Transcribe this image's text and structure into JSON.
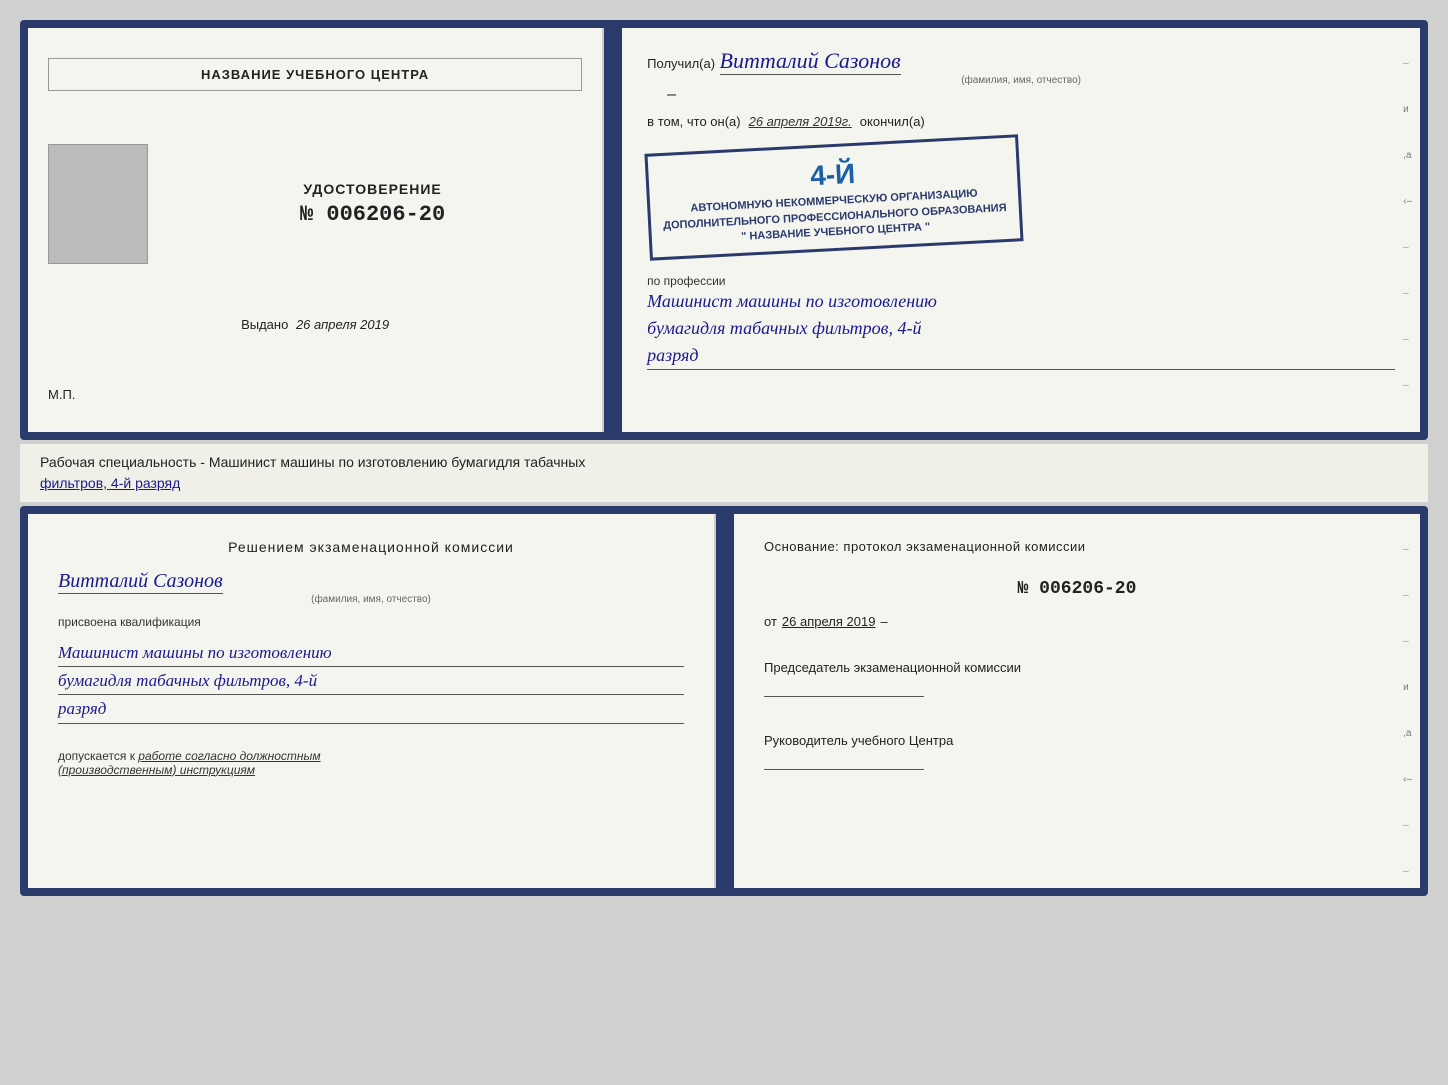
{
  "topCert": {
    "left": {
      "centerName": "НАЗВАНИЕ УЧЕБНОГО ЦЕНТРА",
      "certTitle": "УДОСТОВЕРЕНИЕ",
      "certNumber": "№ 006206-20",
      "issuedLabel": "Выдано",
      "issuedDate": "26 апреля 2019",
      "mpLabel": "М.П."
    },
    "right": {
      "receivedLabel": "Получил(а)",
      "recipientName": "Витталий Сазонов",
      "recipientSubtext": "(фамилия, имя, отчество)",
      "inThatLabel": "в том, что он(а)",
      "completedDate": "26 апреля 2019г.",
      "completedLabel": "окончил(а)",
      "stampBigNum": "4-й",
      "stampLine1": "АВТОНОМНУЮ НЕКОММЕРЧЕСКУЮ ОРГАНИЗАЦИЮ",
      "stampLine2": "ДОПОЛНИТЕЛЬНОГО ПРОФЕССИОНАЛЬНОГО ОБРАЗОВАНИЯ",
      "stampLine3": "\" НАЗВАНИЕ УЧЕБНОГО ЦЕНТРА \"",
      "professionLabel": "по профессии",
      "professionLine1": "Машинист машины по изготовлению",
      "professionLine2": "бумагидля табачных фильтров, 4-й",
      "professionLine3": "разряд"
    }
  },
  "middleSection": {
    "prefix": "Рабочая специальность - Машинист машины по изготовлению бумагидля табачных",
    "underline": "фильтров, 4-й разряд"
  },
  "bottomCert": {
    "left": {
      "decisionTitle": "Решением  экзаменационной  комиссии",
      "personName": "Витталий Сазонов",
      "fioLabel": "(фамилия, имя, отчество)",
      "qualAssigned": "присвоена квалификация",
      "qualLine1": "Машинист машины по изготовлению",
      "qualLine2": "бумагидля табачных фильтров, 4-й",
      "qualLine3": "разряд",
      "allowedPrefix": "допускается к",
      "allowedText": "работе согласно должностным",
      "allowedText2": "(производственным) инструкциям"
    },
    "right": {
      "basisTitle": "Основание:  протокол  экзаменационной  комиссии",
      "protocolNum": "№  006206-20",
      "fromLabel": "от",
      "fromDate": "26 апреля 2019",
      "chairmanLabel": "Председатель экзаменационной\nкомиссии",
      "directorLabel": "Руководитель учебного\nЦентра"
    }
  }
}
